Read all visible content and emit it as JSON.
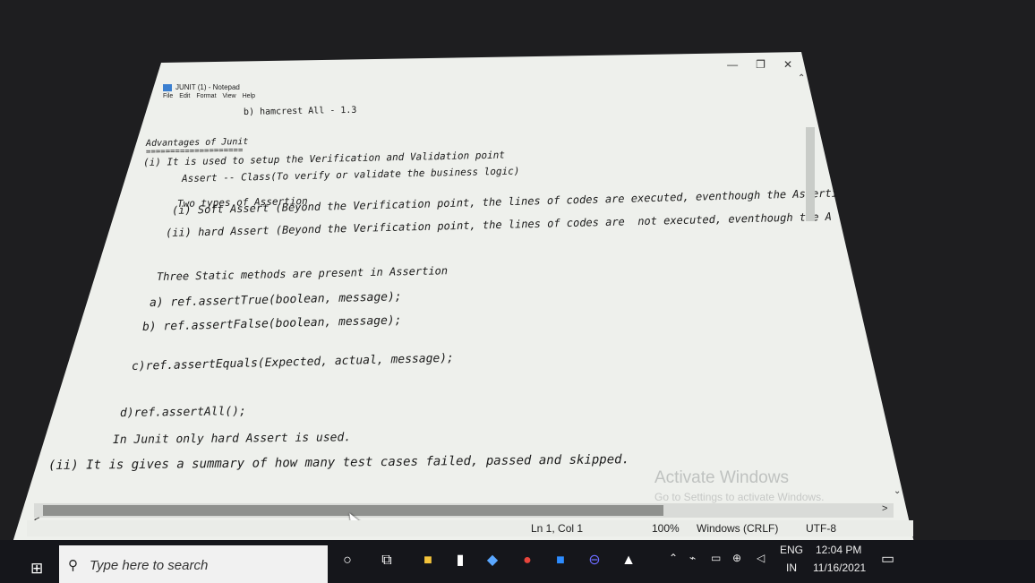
{
  "window": {
    "title": "JUNIT (1) - Notepad",
    "minimize_glyph": "—",
    "maximize_glyph": "❐",
    "close_glyph": "✕"
  },
  "menu": [
    "File",
    "Edit",
    "Format",
    "View",
    "Help"
  ],
  "editor_lines": [
    "b) hamcrest All - 1.3",
    "Advantages of Junit",
    "====================",
    "(i) It is used to setup the Verification and Validation point",
    "Assert -- Class(To verify or validate the business logic)",
    "Two types of Assertion",
    "(i) Soft Assert (Beyond the Verification point, the lines of codes are executed, eventhough the Asserti",
    "(ii) hard Assert (Beyond the Verification point, the lines of codes are  not executed, eventhough the A",
    "Three Static methods are present in Assertion",
    "a) ref.assertTrue(boolean, message);",
    "b) ref.assertFalse(boolean, message);",
    "c)ref.assertEquals(Expected, actual, message);",
    "d)ref.assertAll();",
    "In Junit only hard Assert is used.",
    "(ii) It is gives a summary of how many test cases failed, passed and skipped."
  ],
  "watermark": {
    "line1": "Activate Windows",
    "line2": "Go to Settings to activate Windows."
  },
  "status": {
    "position": "Ln 1, Col 1",
    "zoom": "100%",
    "line_ending": "Windows (CRLF)",
    "encoding": "UTF-8"
  },
  "taskbar": {
    "search_placeholder": "Type here to search",
    "lang_top": "ENG",
    "lang_bottom": "IN",
    "time": "12:04 PM",
    "date": "11/16/2021"
  },
  "icons": [
    "windows-start-icon",
    "search-icon",
    "cortana-icon",
    "task-view-icon",
    "file-explorer-icon",
    "notepad-icon",
    "chrome-icon",
    "zoom-icon",
    "photos-icon",
    "notification-icon"
  ]
}
